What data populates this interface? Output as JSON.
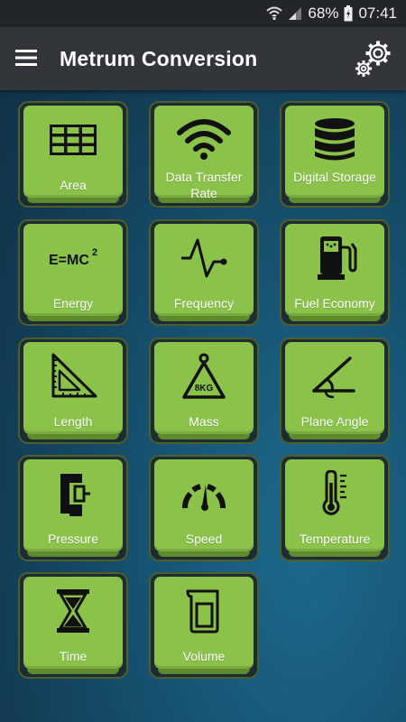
{
  "status": {
    "battery": "68%",
    "time": "07:41"
  },
  "appbar": {
    "title": "Metrum Conversion"
  },
  "tiles": [
    {
      "label": "Area",
      "icon": "grid-icon"
    },
    {
      "label": "Data Transfer Rate",
      "icon": "wifi-icon"
    },
    {
      "label": "Digital Storage",
      "icon": "database-icon"
    },
    {
      "label": "Energy",
      "icon": "emc2-icon",
      "icon_text": "E=MC",
      "icon_sup": "2"
    },
    {
      "label": "Frequency",
      "icon": "waveform-icon"
    },
    {
      "label": "Fuel Economy",
      "icon": "fuel-pump-icon"
    },
    {
      "label": "Length",
      "icon": "set-square-icon"
    },
    {
      "label": "Mass",
      "icon": "weight-icon",
      "icon_text": "8KG"
    },
    {
      "label": "Plane Angle",
      "icon": "angle-icon"
    },
    {
      "label": "Pressure",
      "icon": "clamp-icon"
    },
    {
      "label": "Speed",
      "icon": "speedometer-icon"
    },
    {
      "label": "Temperature",
      "icon": "thermometer-icon"
    },
    {
      "label": "Time",
      "icon": "hourglass-icon"
    },
    {
      "label": "Volume",
      "icon": "beaker-icon"
    }
  ]
}
